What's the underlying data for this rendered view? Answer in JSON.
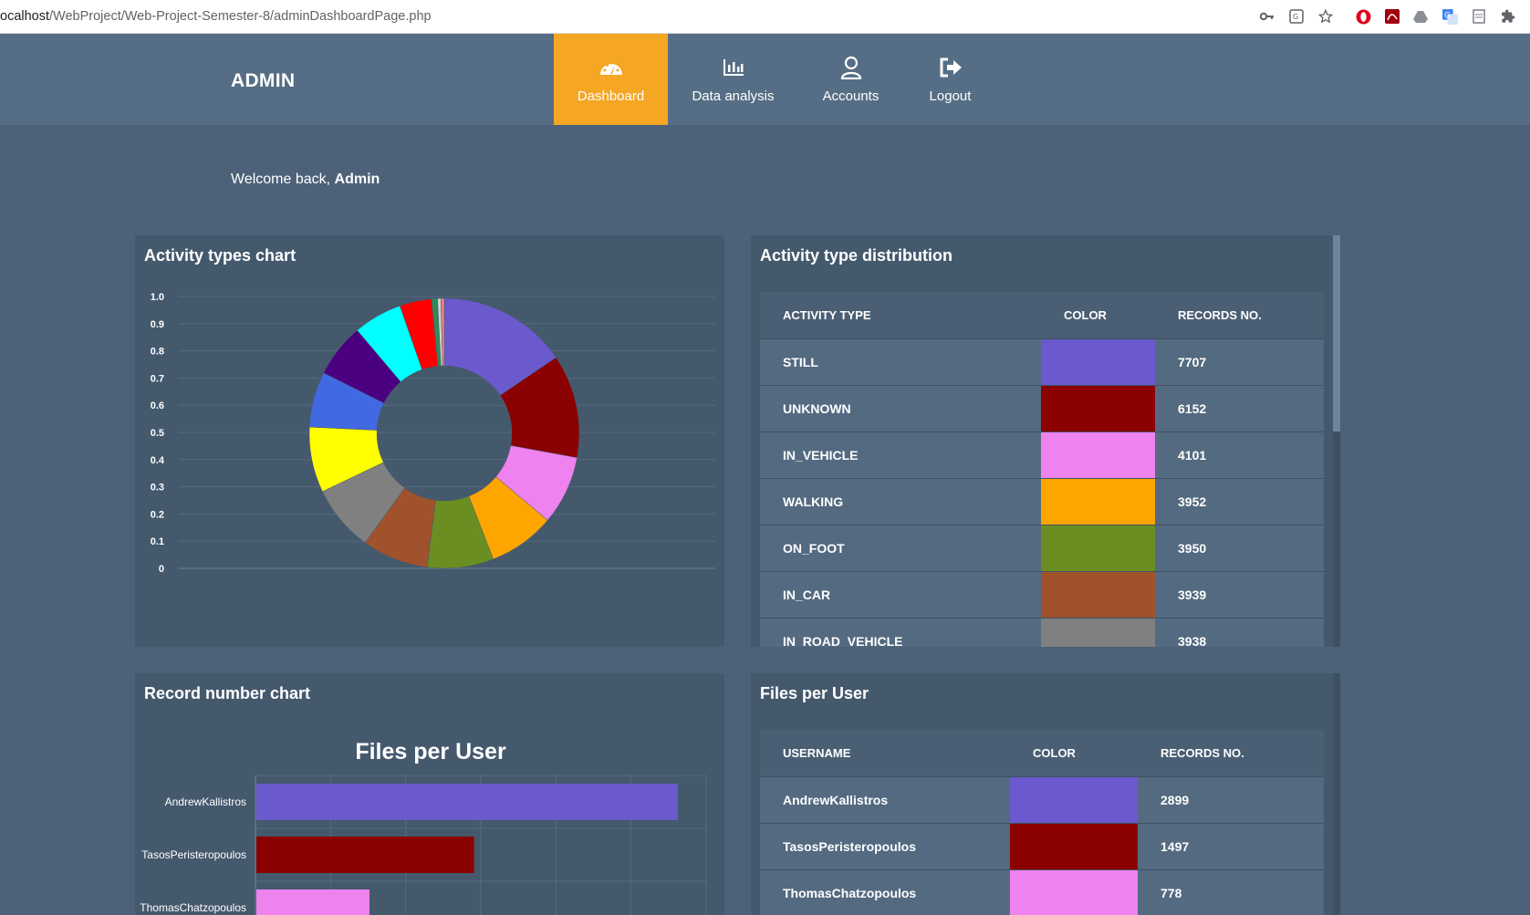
{
  "browser": {
    "url_prefix": "ocalhost",
    "url_path": "/WebProject/Web-Project-Semester-8/adminDashboardPage.php",
    "extensions": [
      "key-icon",
      "translate-icon",
      "star-icon",
      "opera-icon",
      "pdf-icon",
      "drive-icon",
      "translate-icon",
      "page-icon",
      "puzzle-icon"
    ]
  },
  "nav": {
    "brand": "ADMIN",
    "items": [
      {
        "label": "Dashboard",
        "icon": "dashboard-icon",
        "active": true
      },
      {
        "label": "Data analysis",
        "icon": "bar-chart-icon",
        "active": false
      },
      {
        "label": "Accounts",
        "icon": "user-icon",
        "active": false
      },
      {
        "label": "Logout",
        "icon": "logout-icon",
        "active": false
      }
    ],
    "active_color": "#f5a623"
  },
  "welcome": {
    "prefix": "Welcome back, ",
    "name": "Admin"
  },
  "activity_chart_panel": {
    "title": "Activity types chart",
    "chart_data": {
      "type": "pie",
      "variant": "doughnut",
      "yticks": [
        "1.0",
        "0.9",
        "0.8",
        "0.7",
        "0.6",
        "0.5",
        "0.4",
        "0.3",
        "0.2",
        "0.1",
        "0"
      ],
      "slices": [
        {
          "label": "STILL",
          "value": 7707,
          "color": "#6a5acd"
        },
        {
          "label": "UNKNOWN",
          "value": 6152,
          "color": "#8b0000"
        },
        {
          "label": "IN_VEHICLE",
          "value": 4101,
          "color": "#ee82ee"
        },
        {
          "label": "WALKING",
          "value": 3952,
          "color": "#ffa500"
        },
        {
          "label": "ON_FOOT",
          "value": 3950,
          "color": "#6b8e23"
        },
        {
          "label": "IN_CAR",
          "value": 3939,
          "color": "#a0522d"
        },
        {
          "label": "IN_ROAD_VEHICLE",
          "value": 3938,
          "color": "#808080"
        },
        {
          "value": 3900,
          "color": "#ffff00"
        },
        {
          "value": 3300,
          "color": "#4169e1"
        },
        {
          "value": 3200,
          "color": "#4b0082"
        },
        {
          "value": 2900,
          "color": "#00ffff"
        },
        {
          "value": 1900,
          "color": "#ff0000"
        },
        {
          "value": 350,
          "color": "#2e8b57"
        },
        {
          "value": 200,
          "color": "#d3d3d3"
        },
        {
          "value": 200,
          "color": "#f08080"
        }
      ]
    }
  },
  "activity_table": {
    "title": "Activity type distribution",
    "headers": [
      "ACTIVITY TYPE",
      "COLOR",
      "RECORDS NO."
    ],
    "rows": [
      {
        "name": "STILL",
        "color": "#6a5acd",
        "count": "7707"
      },
      {
        "name": "UNKNOWN",
        "color": "#8b0000",
        "count": "6152"
      },
      {
        "name": "IN_VEHICLE",
        "color": "#ee82ee",
        "count": "4101"
      },
      {
        "name": "WALKING",
        "color": "#ffa500",
        "count": "3952"
      },
      {
        "name": "ON_FOOT",
        "color": "#6b8e23",
        "count": "3950"
      },
      {
        "name": "IN_CAR",
        "color": "#a0522d",
        "count": "3939"
      },
      {
        "name": "IN_ROAD_VEHICLE",
        "color": "#808080",
        "count": "3938"
      }
    ]
  },
  "record_chart_panel": {
    "title": "Record number chart",
    "chart_data": {
      "type": "bar",
      "orientation": "horizontal",
      "title": "Files per User",
      "categories": [
        "AndrewKallistros",
        "TasosPeristeropoulos",
        "ThomasChatzopoulos"
      ],
      "values": [
        2899,
        1497,
        778
      ],
      "colors": [
        "#6a5acd",
        "#8b0000",
        "#ee82ee"
      ],
      "xlim": [
        0,
        3100
      ],
      "grid": true
    }
  },
  "files_table": {
    "title": "Files per User",
    "headers": [
      "USERNAME",
      "COLOR",
      "RECORDS NO."
    ],
    "rows": [
      {
        "name": "AndrewKallistros",
        "color": "#6a5acd",
        "count": "2899"
      },
      {
        "name": "TasosPeristeropoulos",
        "color": "#8b0000",
        "count": "1497"
      },
      {
        "name": "ThomasChatzopoulos",
        "color": "#ee82ee",
        "count": "778"
      }
    ]
  }
}
